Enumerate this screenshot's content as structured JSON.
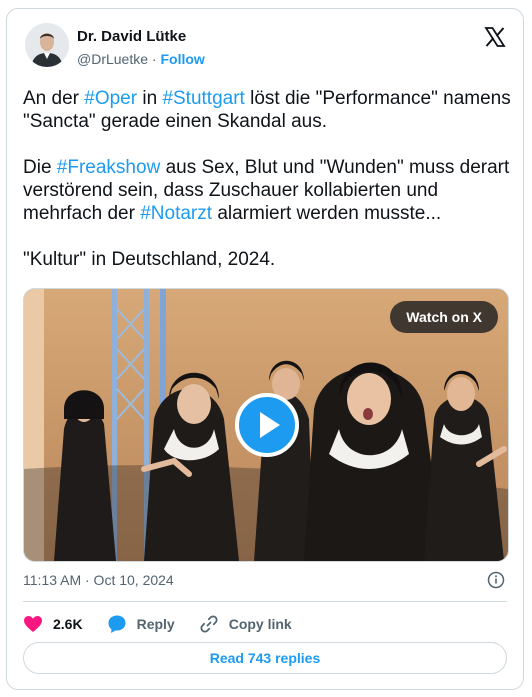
{
  "author": {
    "name": "Dr. David Lütke",
    "handle": "@DrLuetke",
    "separator": "·",
    "follow_label": "Follow"
  },
  "tweet": {
    "line1": {
      "t1": "An der ",
      "tag1": "#Oper",
      "t2": " in ",
      "tag2": "#Stuttgart",
      "t3": " löst die \"Performance\" namens \"Sancta\" gerade einen Skandal aus."
    },
    "line2": {
      "t1": "Die ",
      "tag1": "#Freakshow",
      "t2": " aus Sex, Blut und \"Wunden\" muss derart verstörend sein, dass Zuschauer kollabierten und mehrfach der ",
      "tag2": "#Notarzt",
      "t3": " alarmiert werden musste..."
    },
    "line3": "\"Kultur\" in Deutschland, 2024."
  },
  "media": {
    "watch_label": "Watch on X"
  },
  "timestamp": "11:13 AM · Oct 10, 2024",
  "actions": {
    "likes": "2.6K",
    "reply": "Reply",
    "copy_link": "Copy link"
  },
  "read_replies": "Read 743 replies",
  "colors": {
    "accent": "#1d9bf0",
    "like": "#f91880",
    "text": "#0f1419",
    "muted": "#536471",
    "border": "#cfd9de"
  }
}
